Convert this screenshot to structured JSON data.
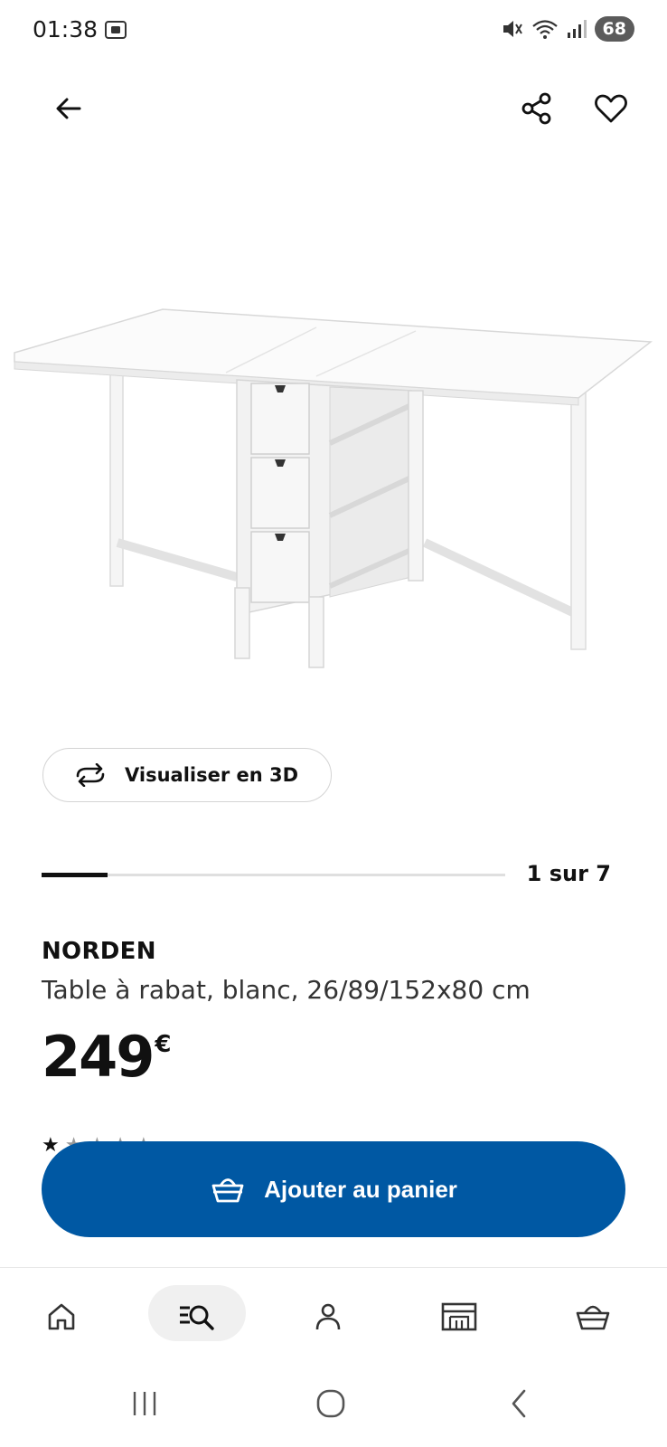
{
  "status_bar": {
    "time": "01:38",
    "battery": "68"
  },
  "icons": {
    "back": "arrow-left-icon",
    "share": "share-icon",
    "favorite": "heart-icon",
    "view_3d": "rotate-3d-icon",
    "cart": "shopping-basket-icon"
  },
  "gallery": {
    "view_3d_label": "Visualiser en 3D",
    "pager": "1 sur 7",
    "progress": 0.143
  },
  "product": {
    "name": "NORDEN",
    "description": "Table à rabat, blanc, 26/89/152x80 cm",
    "price_integer": "249",
    "price_currency": "€"
  },
  "actions": {
    "add_to_cart": "Ajouter au panier"
  },
  "bottom_nav": [
    {
      "icon": "home-icon",
      "active": false
    },
    {
      "icon": "search-list-icon",
      "active": true
    },
    {
      "icon": "profile-icon",
      "active": false
    },
    {
      "icon": "store-icon",
      "active": false
    },
    {
      "icon": "basket-icon",
      "active": false
    }
  ],
  "colors": {
    "primary": "#0058a3",
    "text": "#111111",
    "divider": "#dfdfdf"
  }
}
